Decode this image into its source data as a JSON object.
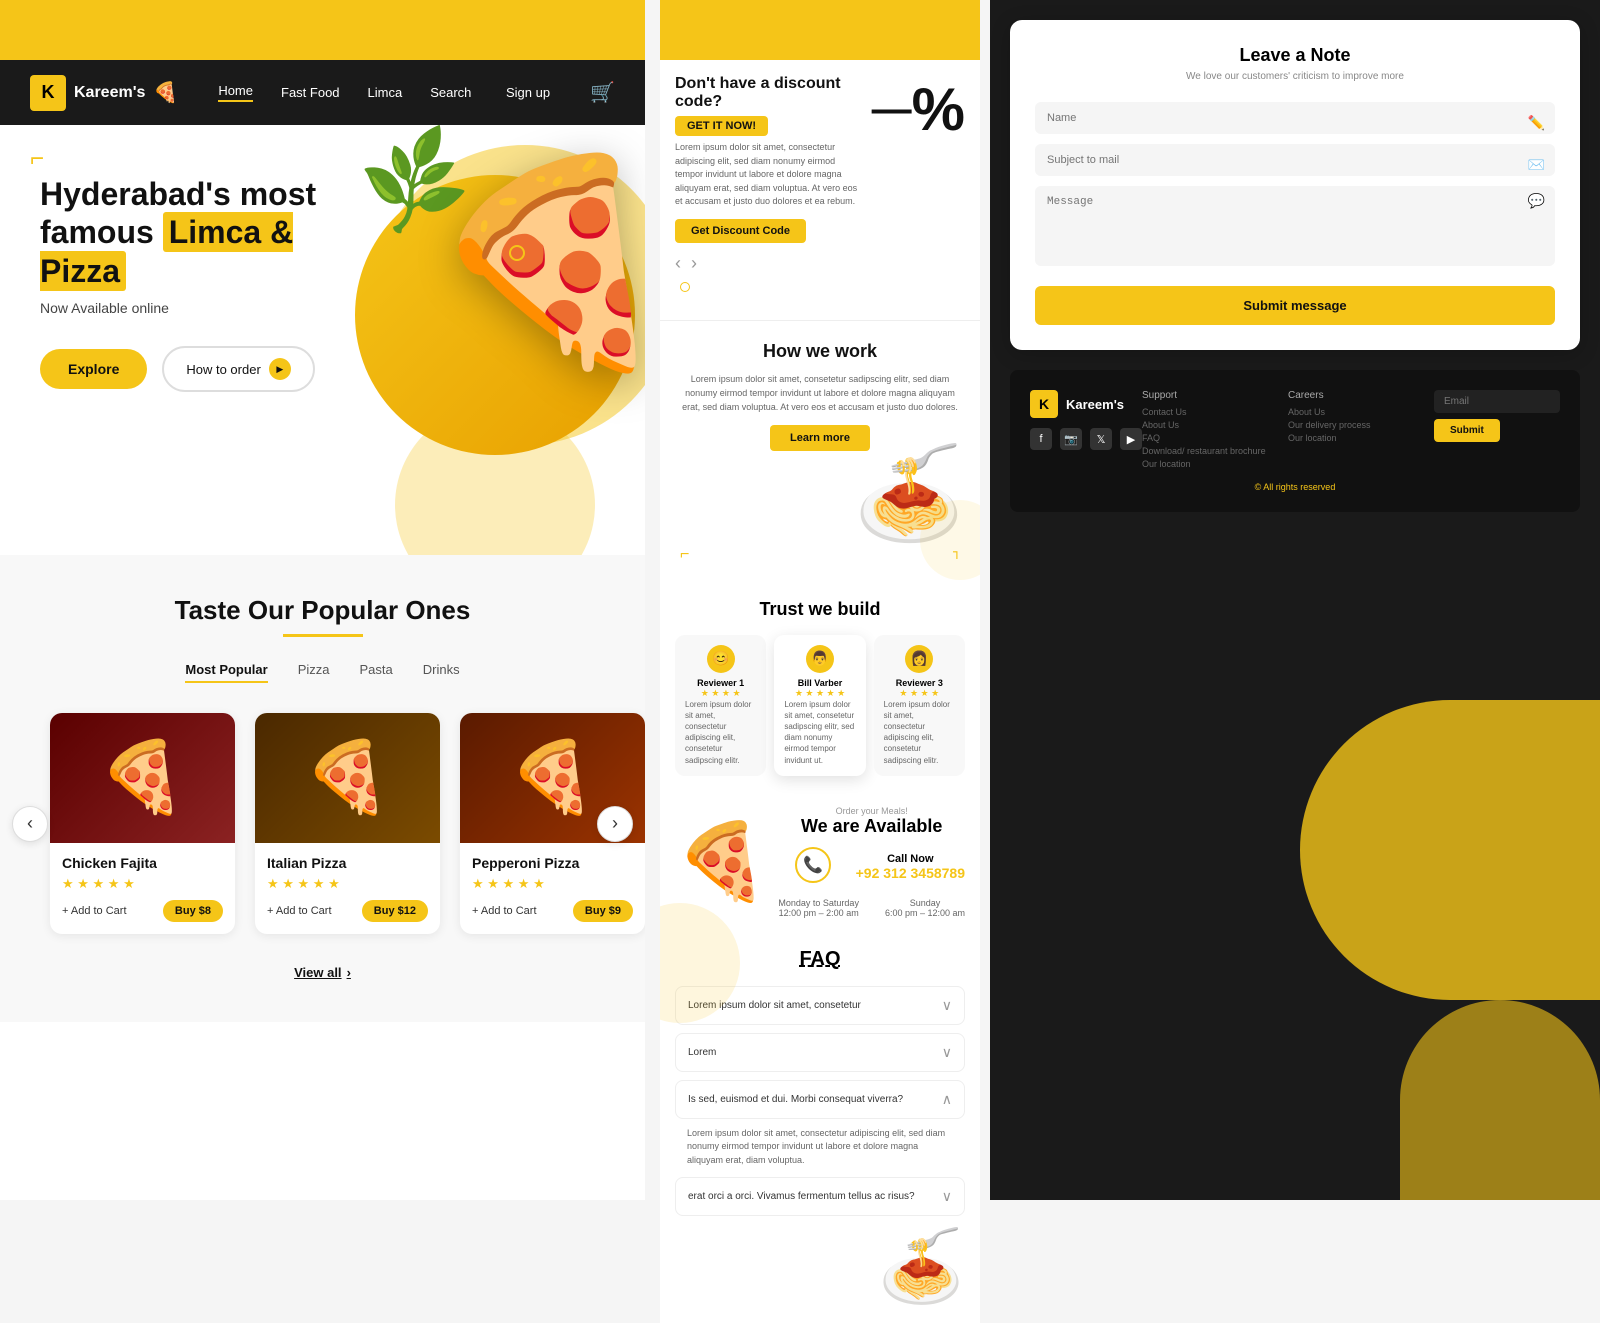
{
  "brand": {
    "logo_letter": "K",
    "name": "Kareem's",
    "tagline": "🍕"
  },
  "navbar": {
    "links": [
      "Home",
      "Fast Food",
      "Limca",
      "Search",
      "Sign up"
    ],
    "active_link": "Home",
    "fast_food_label": "Fast Food",
    "limca_label": "Limca",
    "search_label": "Search",
    "signup_label": "Sign up",
    "cart_icon": "🛒"
  },
  "hero": {
    "line1": "Hyderabad's most",
    "line2": "famous",
    "highlight": "Limca & Pizza",
    "subtitle": "Now Available online",
    "btn_explore": "Explore",
    "btn_how_to_order": "How to order"
  },
  "popular": {
    "title": "Taste Our Popular Ones",
    "categories": [
      "Most Popular",
      "Pizza",
      "Pasta",
      "Drinks"
    ],
    "active_category": "Most Popular",
    "products": [
      {
        "name": "Chicken Fajita",
        "rating": "★ ★ ★ ★ ★",
        "add_to_cart": "+ Add to Cart",
        "buy_label": "Buy $8",
        "emoji": "🍕"
      },
      {
        "name": "Italian Pizza",
        "rating": "★ ★ ★ ★ ★",
        "add_to_cart": "+ Add to Cart",
        "buy_label": "Buy $12",
        "emoji": "🍕"
      },
      {
        "name": "Pepperoni Pizza",
        "rating": "★ ★ ★ ★ ★",
        "add_to_cart": "+ Add to Cart",
        "buy_label": "Buy $9",
        "emoji": "🍕"
      }
    ],
    "view_all": "View all"
  },
  "discount": {
    "title": "Don't have a discount code?",
    "get_it_label": "GET IT NOW!",
    "body_text": "Lorem ipsum dolor sit amet, consectetur adipiscing elit, sed diam nonumy eirmod tempor invidunt ut labore et dolore magna aliquyam erat, sed diam voluptua. At vero eos et accusam et justo duo dolores et ea rebum.",
    "btn_label": "Get Discount Code",
    "dash": "—",
    "percent": "%"
  },
  "how_we_work": {
    "title": "How we work",
    "description": "Lorem ipsum dolor sit amet, consetetur sadipscing elitr, sed diam nonumy eirmod tempor invidunt ut labore et dolore magna aliquyam erat, sed diam voluptua. At vero eos et accusam et justo duo dolores.",
    "btn_label": "Learn more"
  },
  "trust": {
    "title": "Trust we build",
    "reviews": [
      {
        "name": "Reviewer 1",
        "stars": "★ ★ ★ ★",
        "text": "Lorem ipsum dolor sit amet, consectetur adipiscing elit, consetetur sadipscing elitr.",
        "avatar": "😊"
      },
      {
        "name": "Bill Varber",
        "stars": "★ ★ ★ ★ ★",
        "text": "Lorem ipsum dolor sit amet, consetetur sadipscing elitr, sed diam nonumy eirmod tempor invidunt ut.",
        "avatar": "👨"
      },
      {
        "name": "Reviewer 3",
        "stars": "★ ★ ★ ★",
        "text": "Lorem ipsum dolor sit amet, consectetur adipiscing elit, consetetur sadipscing elitr.",
        "avatar": "👩"
      }
    ]
  },
  "available": {
    "order_label": "Order your Meals!",
    "title": "We are Available",
    "call_now": "Call Now",
    "phone": "+92 312 3458789",
    "monday_to_sat": "Monday to Saturday",
    "mon_hours": "12:00 pm – 2:00 am",
    "sunday": "Sunday",
    "sun_hours": "6:00 pm – 12:00 am"
  },
  "faq": {
    "title": "FAQ",
    "items": [
      {
        "question": "Lorem ipsum dolor sit amet, consetetur",
        "open": false,
        "answer": ""
      },
      {
        "question": "Lorem",
        "open": false,
        "answer": ""
      },
      {
        "question": "Is sed, euismod et dui. Morbi consequat viverra?",
        "open": true,
        "answer": "Lorem ipsum dolor sit amet, consectetur adipiscing elit, sed diam nonumy eirmod tempor invidunt ut labore et dolore magna aliquyam erat, diam voluptua."
      },
      {
        "question": "erat orci a orci. Vivamus fermentum tellus ac risus?",
        "open": false,
        "answer": ""
      }
    ]
  },
  "leave_note": {
    "title": "Leave a Note",
    "subtitle": "We love our customers' criticism to improve more",
    "name_placeholder": "Name",
    "subject_placeholder": "Subject to mail",
    "message_placeholder": "Message",
    "submit_btn": "Submit message"
  },
  "footer": {
    "support_label": "Support",
    "careers_label": "Careers",
    "support_links": [
      "Contact Us",
      "About Us",
      "FAQ",
      "Download/ restaurant brochure",
      "Our location"
    ],
    "careers_links": [
      "About Us",
      "Our delivery process",
      "Our location"
    ],
    "email_placeholder": "Email",
    "submit_btn": "Submit",
    "all_rights": "© All rights reserved"
  }
}
